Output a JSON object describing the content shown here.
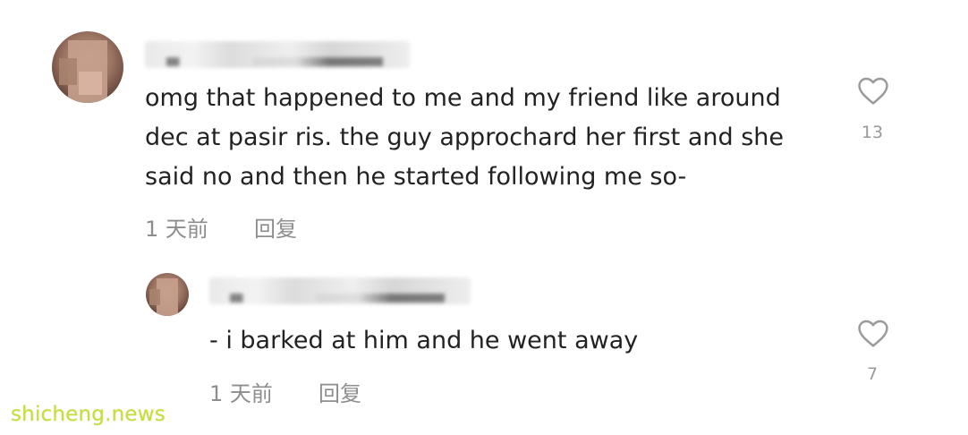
{
  "comments": [
    {
      "text_lines": [
        "omg that happened to me and my friend like around",
        "dec at pasir ris. the guy approchard her first and she",
        "said no and then he started following me so-"
      ],
      "time": "1 天前",
      "reply_label": "回复",
      "like_count": "13",
      "icon": "heart-outline-icon"
    },
    {
      "text_lines": [
        "- i barked at him and he went away"
      ],
      "time": "1 天前",
      "reply_label": "回复",
      "like_count": "7",
      "icon": "heart-outline-icon"
    }
  ],
  "watermark": "shicheng.news",
  "colors": {
    "text": "#222222",
    "meta": "#8d8d8d",
    "watermark": "#c8df3b"
  }
}
